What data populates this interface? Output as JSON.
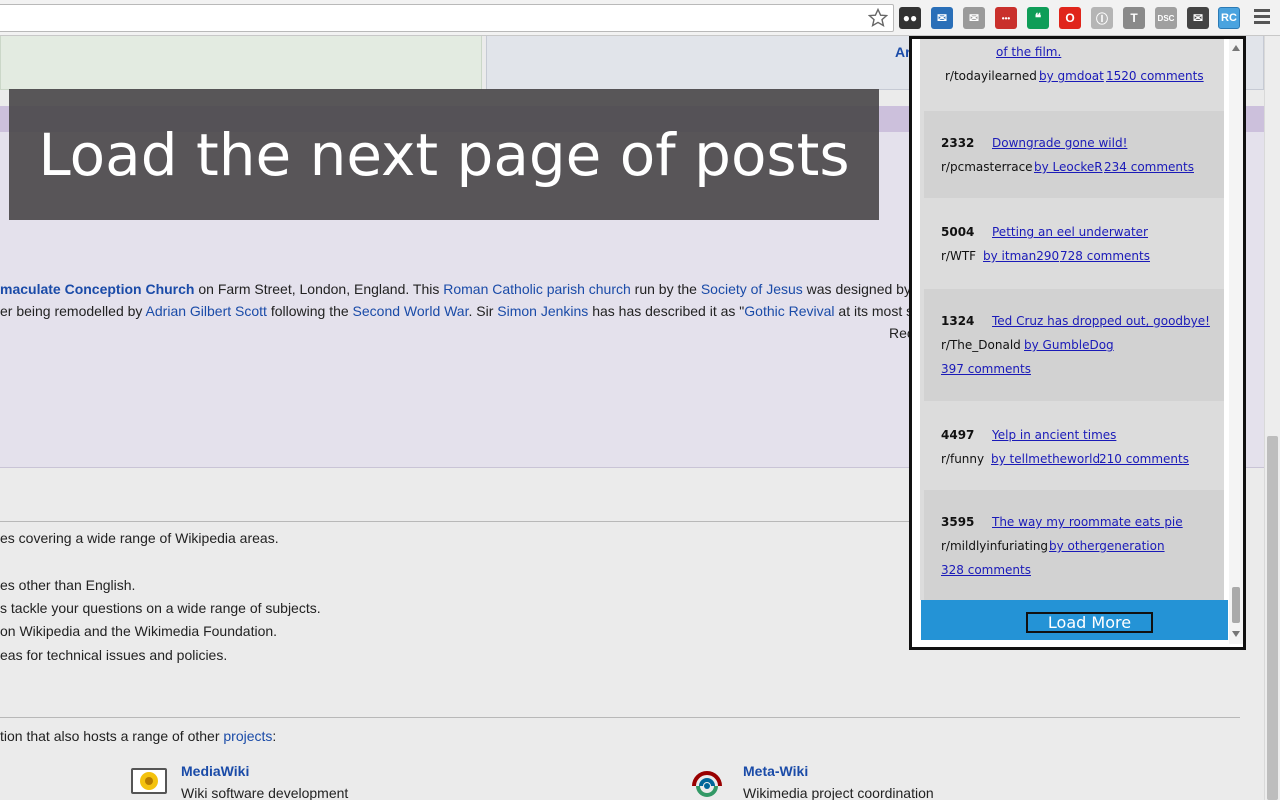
{
  "browser": {
    "extensions": [
      {
        "name": "tampermonkey-icon",
        "color": "#333333",
        "glyph": "●●"
      },
      {
        "name": "mail-checker-icon",
        "color": "#2a6fb8",
        "glyph": "✉"
      },
      {
        "name": "gmail-icon",
        "color": "#9a9a9a",
        "glyph": "✉"
      },
      {
        "name": "lastpass-icon",
        "color": "#c9302c",
        "glyph": "•••"
      },
      {
        "name": "hangouts-icon",
        "color": "#0f9d58",
        "glyph": "❝"
      },
      {
        "name": "opera-icon",
        "color": "#e0251b",
        "glyph": "O"
      },
      {
        "name": "pocket-icon",
        "color": "#b5b5b5",
        "glyph": "Ⓘ"
      },
      {
        "name": "text-extension-icon",
        "color": "#8a8a8a",
        "glyph": "T"
      },
      {
        "name": "dsc-extension-icon",
        "color": "#a0a0a0",
        "glyph": "DSC"
      },
      {
        "name": "inbox-icon",
        "color": "#444444",
        "glyph": "✉"
      }
    ],
    "active_extension_label": "RC"
  },
  "wiki": {
    "top_link": "Ar",
    "featured": {
      "line1": {
        "bold_link": "maculate Conception Church",
        "t1": " on Farm Street, London, England. This ",
        "link1": "Roman Catholic parish church",
        "t2": " run by the ",
        "link2": "Society of Jesus",
        "t3": " was designed by"
      },
      "line2": {
        "t1": "er being remodelled by ",
        "link1": "Adrian Gilbert Scott",
        "t2": " following the ",
        "link2": "Second World War",
        "t3": ". Sir ",
        "link3": "Simon Jenkins",
        "t4": " has has described it as \"",
        "link4": "Gothic Revival",
        "t5": " at its most s"
      },
      "rec": "Rec"
    },
    "lines": [
      "es covering a wide range of Wikipedia areas.",
      "es other than English.",
      "s tackle your questions on a wide range of subjects.",
      "on Wikipedia and the Wikimedia Foundation.",
      "eas for technical issues and policies."
    ],
    "projects_intro": "tion that also hosts a range of other ",
    "projects_link": "projects",
    "projects_colon": ":",
    "projects": [
      {
        "title": "MediaWiki",
        "desc": "Wiki software development"
      },
      {
        "title": "Meta-Wiki",
        "desc": "Wikimedia project coordination"
      }
    ]
  },
  "tooltip": "Load the next page of posts",
  "popup": {
    "partial_title": "of the film.",
    "partial_sub": "r/todayilearned",
    "partial_by": "by gmdoat",
    "partial_comments": "1520 comments",
    "posts": [
      {
        "score": "2332",
        "title": "Downgrade gone wild!",
        "sub": "r/pcmasterrace",
        "by": "by LeockeR",
        "comments": "234 comments"
      },
      {
        "score": "5004",
        "title": "Petting an eel underwater",
        "sub": "r/WTF",
        "by": "by itman290",
        "comments": "728 comments"
      },
      {
        "score": "1324",
        "title": "Ted Cruz has dropped out, goodbye!",
        "sub": "r/The_Donald",
        "by": "by GumbleDog",
        "comments": "397 comments"
      },
      {
        "score": "4497",
        "title": "Yelp in ancient times",
        "sub": "r/funny",
        "by": "by tellmetheworld",
        "comments": "210 comments"
      },
      {
        "score": "3595",
        "title": "The way my roommate eats pie",
        "sub": "r/mildlyinfuriating",
        "by": "by othergeneration",
        "comments": "328 comments"
      }
    ],
    "load_more": "Load More"
  }
}
